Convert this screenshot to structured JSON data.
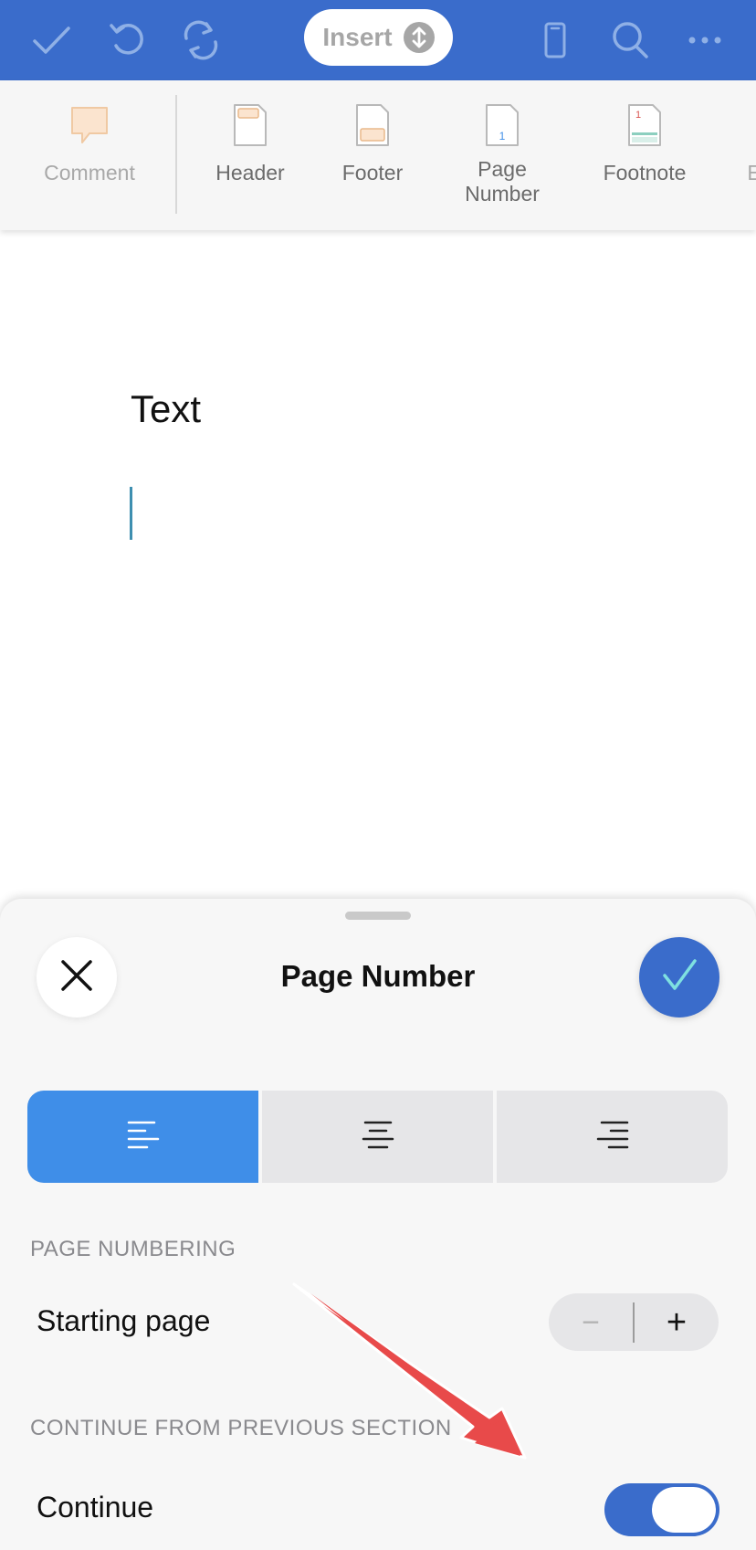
{
  "toolbar": {
    "mode_label": "Insert",
    "icons": [
      "checkmark-icon",
      "undo-icon",
      "redo-icon",
      "swap-icon",
      "phone-view-icon",
      "search-icon",
      "more-icon"
    ],
    "accent_color": "#3a6ccb"
  },
  "ribbon": {
    "items": [
      {
        "label": "Comment",
        "icon": "comment-icon",
        "enabled": false
      },
      {
        "label": "Header",
        "icon": "header-icon",
        "enabled": true
      },
      {
        "label": "Footer",
        "icon": "footer-icon",
        "enabled": true
      },
      {
        "label": "Page\nNumber",
        "icon": "page-number-icon",
        "enabled": true
      },
      {
        "label": "Footnote",
        "icon": "footnote-icon",
        "enabled": true
      },
      {
        "label": "E",
        "icon": "",
        "enabled": true
      }
    ]
  },
  "document": {
    "text": "Text"
  },
  "sheet": {
    "title": "Page Number",
    "alignment": {
      "options": [
        "align-left-icon",
        "align-center-icon",
        "align-right-icon"
      ],
      "selected": 0,
      "active_color": "#3f8ee8"
    },
    "page_numbering": {
      "heading": "PAGE NUMBERING",
      "starting_page_label": "Starting page",
      "decrement_label": "−",
      "increment_label": "+"
    },
    "continue_section": {
      "heading": "CONTINUE FROM PREVIOUS SECTION",
      "continue_label": "Continue",
      "continue_on": true
    }
  }
}
